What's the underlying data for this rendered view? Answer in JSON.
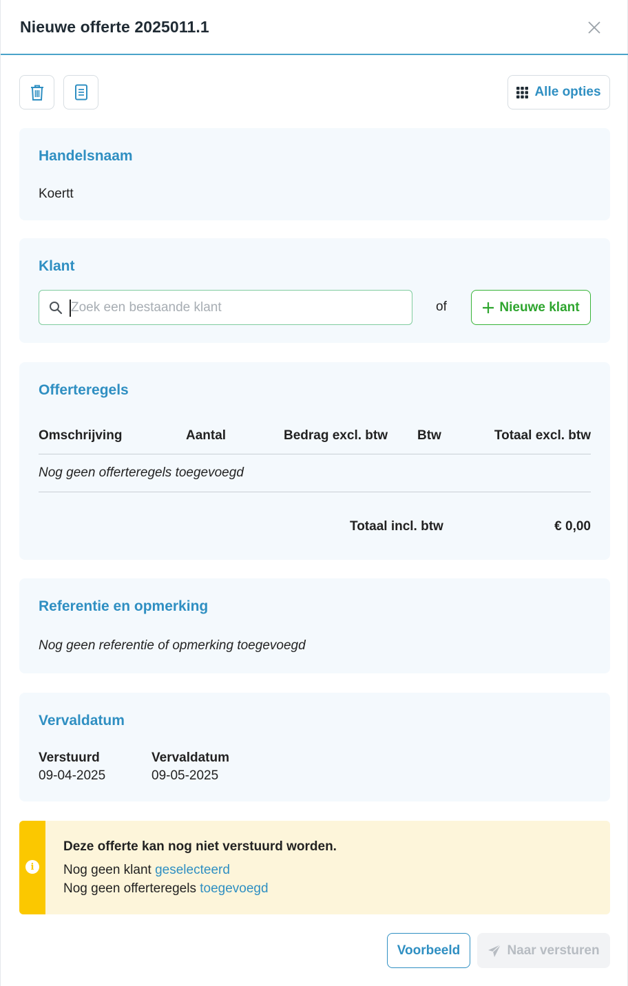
{
  "header": {
    "title": "Nieuwe offerte 2025011.1"
  },
  "icons": {
    "close": "close-icon",
    "trash": "trash-icon",
    "document": "document-icon",
    "grid": "grid-icon",
    "search": "search-icon",
    "plus": "plus-icon",
    "info": "info-icon",
    "send": "send-icon"
  },
  "toolbar": {
    "alle_opties_label": "Alle opties"
  },
  "handelsnaam": {
    "title": "Handelsnaam",
    "value": "Koertt"
  },
  "klant": {
    "title": "Klant",
    "search_placeholder": "Zoek een bestaande klant",
    "search_value": "",
    "or_label": "of",
    "new_button_label": "Nieuwe klant"
  },
  "offerteregels": {
    "title": "Offerteregels",
    "columns": [
      "Omschrijving",
      "Aantal",
      "Bedrag excl. btw",
      "Btw",
      "Totaal excl. btw"
    ],
    "empty_text": "Nog geen offerteregels toegevoegd",
    "total_label": "Totaal incl. btw",
    "total_value": "€ 0,00"
  },
  "referentie": {
    "title": "Referentie en opmerking",
    "empty_text": "Nog geen referentie of opmerking toegevoegd"
  },
  "vervaldatum": {
    "title": "Vervaldatum",
    "sent_label": "Verstuurd",
    "sent_value": "09-04-2025",
    "due_label": "Vervaldatum",
    "due_value": "09-05-2025"
  },
  "alert": {
    "heading": "Deze offerte kan nog niet verstuurd worden.",
    "line1_text": "Nog geen klant",
    "line1_link": "geselecteerd",
    "line2_text": "Nog geen offerteregels",
    "line2_link": "toegevoegd"
  },
  "footer": {
    "preview_label": "Voorbeeld",
    "send_label": "Naar versturen"
  },
  "colors": {
    "accent": "#2f8fc2",
    "green": "#2ea52e",
    "warning": "#fbc800",
    "warning_bg": "#fdf5da",
    "card_bg": "#f4f9fd"
  }
}
